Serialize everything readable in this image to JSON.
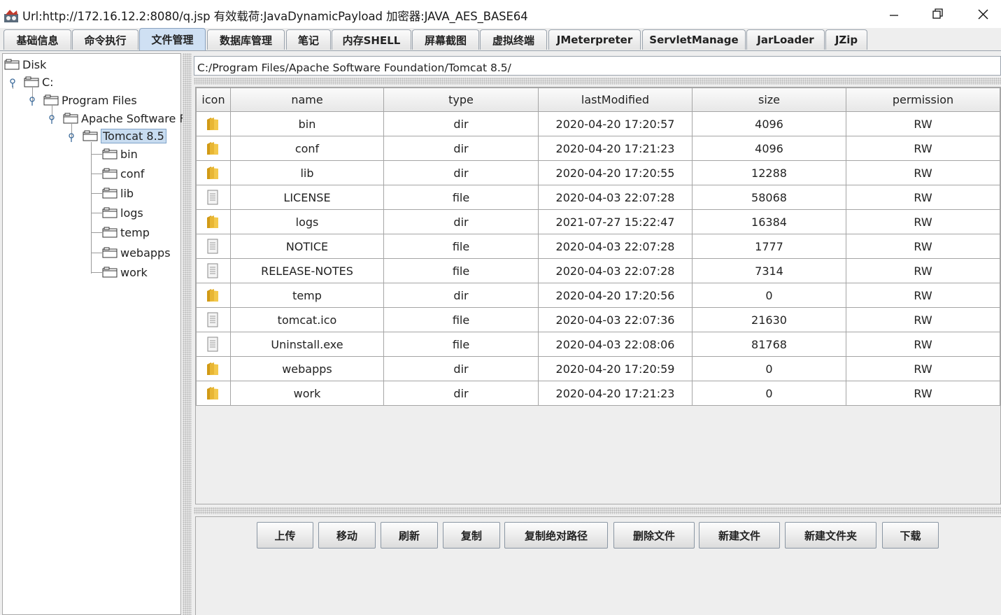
{
  "window": {
    "title": "Url:http://172.16.12.2:8080/q.jsp 有效载荷:JavaDynamicPayload 加密器:JAVA_AES_BASE64"
  },
  "tabs": [
    {
      "label": "基础信息"
    },
    {
      "label": "命令执行"
    },
    {
      "label": "文件管理"
    },
    {
      "label": "数据库管理"
    },
    {
      "label": "笔记"
    },
    {
      "label": "内存SHELL"
    },
    {
      "label": "屏幕截图"
    },
    {
      "label": "虚拟终端"
    },
    {
      "label": "JMeterpreter"
    },
    {
      "label": "ServletManage"
    },
    {
      "label": "JarLoader"
    },
    {
      "label": "JZip"
    }
  ],
  "active_tab": "文件管理",
  "tree": {
    "root": "Disk",
    "drive": "C:",
    "program_files": "Program Files",
    "apache": "Apache Software F",
    "tomcat": "Tomcat 8.5",
    "children": [
      "bin",
      "conf",
      "lib",
      "logs",
      "temp",
      "webapps",
      "work"
    ]
  },
  "path": "C:/Program Files/Apache Software Foundation/Tomcat 8.5/",
  "table": {
    "columns": [
      "icon",
      "name",
      "type",
      "lastModified",
      "size",
      "permission"
    ],
    "rows": [
      {
        "icon": "folder-icon",
        "name": "bin",
        "type": "dir",
        "lastModified": "2020-04-20 17:20:57",
        "size": "4096",
        "permission": "RW"
      },
      {
        "icon": "folder-icon",
        "name": "conf",
        "type": "dir",
        "lastModified": "2020-04-20 17:21:23",
        "size": "4096",
        "permission": "RW"
      },
      {
        "icon": "folder-icon",
        "name": "lib",
        "type": "dir",
        "lastModified": "2020-04-20 17:20:55",
        "size": "12288",
        "permission": "RW"
      },
      {
        "icon": "file-icon",
        "name": "LICENSE",
        "type": "file",
        "lastModified": "2020-04-03 22:07:28",
        "size": "58068",
        "permission": "RW"
      },
      {
        "icon": "folder-icon",
        "name": "logs",
        "type": "dir",
        "lastModified": "2021-07-27 15:22:47",
        "size": "16384",
        "permission": "RW"
      },
      {
        "icon": "file-icon",
        "name": "NOTICE",
        "type": "file",
        "lastModified": "2020-04-03 22:07:28",
        "size": "1777",
        "permission": "RW"
      },
      {
        "icon": "file-icon",
        "name": "RELEASE-NOTES",
        "type": "file",
        "lastModified": "2020-04-03 22:07:28",
        "size": "7314",
        "permission": "RW"
      },
      {
        "icon": "folder-icon",
        "name": "temp",
        "type": "dir",
        "lastModified": "2020-04-20 17:20:56",
        "size": "0",
        "permission": "RW"
      },
      {
        "icon": "file-icon",
        "name": "tomcat.ico",
        "type": "file",
        "lastModified": "2020-04-03 22:07:36",
        "size": "21630",
        "permission": "RW"
      },
      {
        "icon": "file-icon",
        "name": "Uninstall.exe",
        "type": "file",
        "lastModified": "2020-04-03 22:08:06",
        "size": "81768",
        "permission": "RW"
      },
      {
        "icon": "folder-icon",
        "name": "webapps",
        "type": "dir",
        "lastModified": "2020-04-20 17:20:59",
        "size": "0",
        "permission": "RW"
      },
      {
        "icon": "folder-icon",
        "name": "work",
        "type": "dir",
        "lastModified": "2020-04-20 17:21:23",
        "size": "0",
        "permission": "RW"
      }
    ]
  },
  "buttons": [
    {
      "label": "上传"
    },
    {
      "label": "移动"
    },
    {
      "label": "刷新"
    },
    {
      "label": "复制"
    },
    {
      "label": "复制绝对路径"
    },
    {
      "label": "删除文件"
    },
    {
      "label": "新建文件"
    },
    {
      "label": "新建文件夹"
    },
    {
      "label": "下载"
    }
  ],
  "colors": {
    "active_tab": "#cfe0f3",
    "folder": "#e8b634",
    "selection": "#c8dcf0"
  }
}
